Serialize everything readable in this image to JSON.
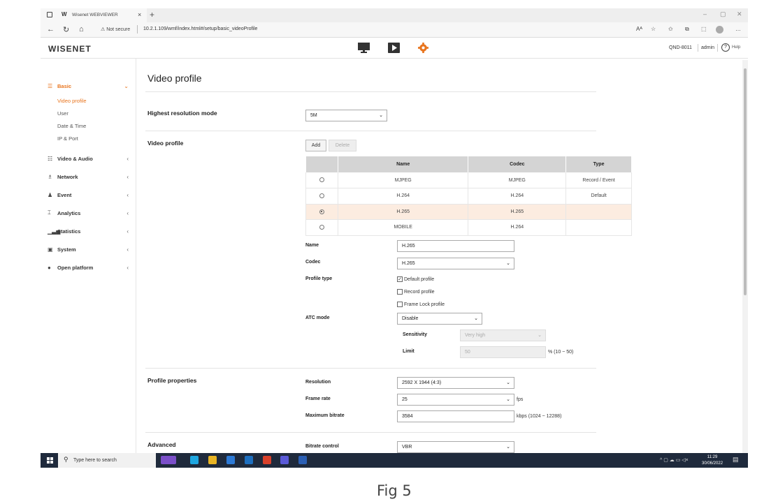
{
  "browser": {
    "tab_title": "Wisenet WEBVIEWER",
    "tab_favicon": "W",
    "new_tab": "+",
    "security_label": "Not secure",
    "url": "10.2.1.109/wmf/index.html#/setup/basic_videoProfile"
  },
  "header": {
    "logo": "WISENET",
    "device": "QND-8011",
    "user": "admin",
    "help": "Help",
    "accent": "#e8741d"
  },
  "sidebar": {
    "items": [
      {
        "label": "Basic",
        "icon": "list-icon"
      },
      {
        "label": "Video & Audio",
        "icon": "sliders-icon"
      },
      {
        "label": "Network",
        "icon": "network-icon"
      },
      {
        "label": "Event",
        "icon": "bell-icon"
      },
      {
        "label": "Analytics",
        "icon": "analytics-icon"
      },
      {
        "label": "Statistics",
        "icon": "bar-chart-icon"
      },
      {
        "label": "System",
        "icon": "system-icon"
      },
      {
        "label": "Open platform",
        "icon": "platform-icon"
      }
    ],
    "basic_sub": [
      "Video profile",
      "User",
      "Date & Time",
      "IP & Port"
    ]
  },
  "main": {
    "title": "Video profile",
    "highest_resolution": {
      "label": "Highest resolution mode",
      "value": "5M"
    },
    "video_profile": {
      "label": "Video profile",
      "add": "Add",
      "delete": "Delete",
      "columns": [
        "Name",
        "Codec",
        "Type"
      ],
      "rows": [
        {
          "name": "MJPEG",
          "codec": "MJPEG",
          "type": "Record / Event",
          "selected": false
        },
        {
          "name": "H.264",
          "codec": "H.264",
          "type": "Default",
          "selected": false
        },
        {
          "name": "H.265",
          "codec": "H.265",
          "type": "",
          "selected": true
        },
        {
          "name": "MOBILE",
          "codec": "H.264",
          "type": "",
          "selected": false
        }
      ]
    },
    "detail": {
      "name_label": "Name",
      "name_value": "H.265",
      "codec_label": "Codec",
      "codec_value": "H.265",
      "profile_type_label": "Profile type",
      "profile_types": [
        {
          "label": "Default profile",
          "checked": true
        },
        {
          "label": "Record profile",
          "checked": false
        },
        {
          "label": "Frame Lock profile",
          "checked": false
        }
      ],
      "atc_label": "ATC mode",
      "atc_value": "Disable",
      "sensitivity_label": "Sensitivity",
      "sensitivity_value": "Very high",
      "limit_label": "Limit",
      "limit_value": "50",
      "limit_unit": "% (10 ~ 50)"
    },
    "profile_properties": {
      "label": "Profile properties",
      "resolution_label": "Resolution",
      "resolution_value": "2592 X 1944 (4:3)",
      "framerate_label": "Frame rate",
      "framerate_value": "25",
      "framerate_unit": "fps",
      "bitrate_label": "Maximum bitrate",
      "bitrate_value": "3584",
      "bitrate_unit": "kbps (1024 ~ 12288)"
    },
    "advanced": {
      "label": "Advanced",
      "bitrate_control_label": "Bitrate control",
      "bitrate_control_value": "VBR"
    }
  },
  "taskbar": {
    "search_placeholder": "Type here to search",
    "time": "11:29",
    "date": "30/06/2022"
  },
  "caption": "Fig 5"
}
